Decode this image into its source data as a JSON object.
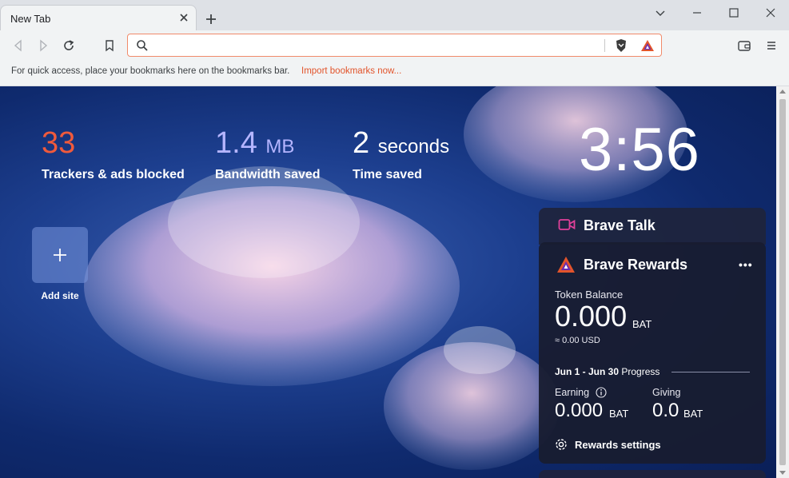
{
  "tab": {
    "title": "New Tab"
  },
  "bookmarks_bar": {
    "hint": "For quick access, place your bookmarks here on the bookmarks bar.",
    "import_link": "Import bookmarks now..."
  },
  "stats": {
    "trackers": {
      "value": "33",
      "label": "Trackers & ads blocked",
      "color": "#f05a3c"
    },
    "bandwidth": {
      "value": "1.4",
      "unit": "MB",
      "label": "Bandwidth saved",
      "color": "#b5b5ff"
    },
    "time": {
      "value": "2",
      "unit": "seconds",
      "label": "Time saved"
    }
  },
  "clock": "3:56",
  "top_sites": {
    "add_label": "Add site"
  },
  "brave_talk": {
    "title": "Brave Talk"
  },
  "rewards": {
    "title": "Brave Rewards",
    "more": "•••",
    "balance_label": "Token Balance",
    "balance": "0.000",
    "balance_unit": "BAT",
    "usd": "≈ 0.00 USD",
    "period": "Jun 1 - Jun 30",
    "progress_label": "Progress",
    "earning_label": "Earning",
    "earning_value": "0.000",
    "earning_unit": "BAT",
    "giving_label": "Giving",
    "giving_value": "0.0",
    "giving_unit": "BAT",
    "settings_label": "Rewards settings"
  },
  "colors": {
    "accent": "#e2542b",
    "omnibox_border": "#f18a6a"
  }
}
